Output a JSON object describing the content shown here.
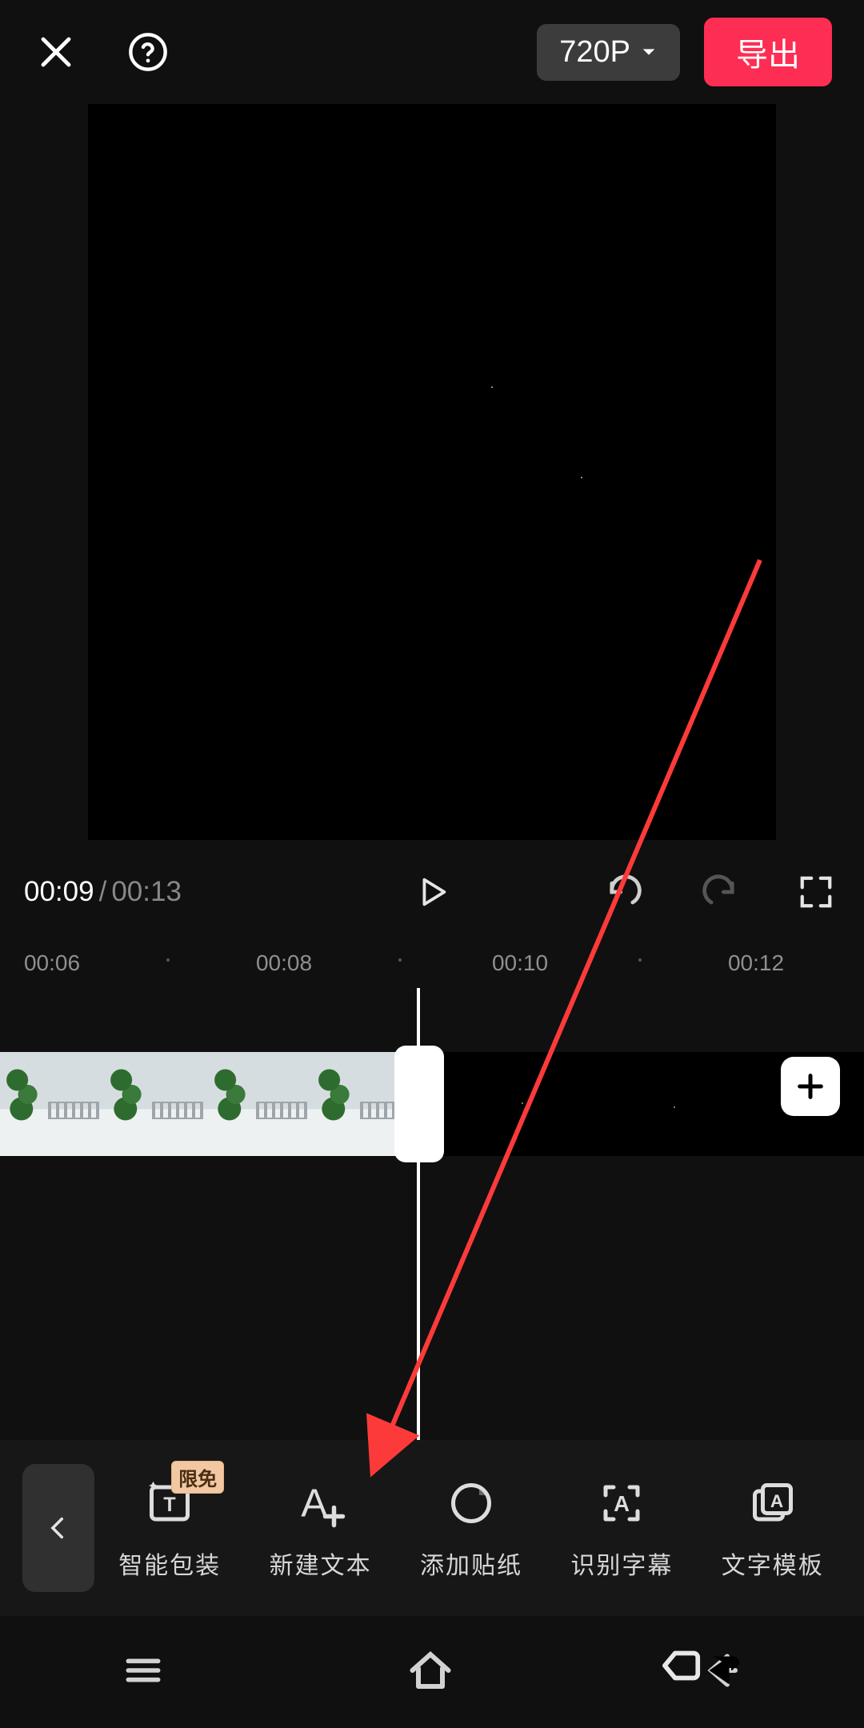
{
  "header": {
    "resolution_label": "720P",
    "export_label": "导出"
  },
  "transport": {
    "current_time": "00:09",
    "separator": "/",
    "total_time": "00:13"
  },
  "ruler": {
    "labels": [
      "00:06",
      "00:08",
      "00:10",
      "00:12"
    ]
  },
  "tools": [
    {
      "label": "智能包装",
      "icon": "text-sparkle",
      "badge": "限免"
    },
    {
      "label": "新建文本",
      "icon": "text-add",
      "badge": null
    },
    {
      "label": "添加贴纸",
      "icon": "sticker",
      "badge": null
    },
    {
      "label": "识别字幕",
      "icon": "caption-detect",
      "badge": null
    },
    {
      "label": "文字模板",
      "icon": "text-template",
      "badge": null
    }
  ],
  "colors": {
    "accent": "#fe2d53",
    "badge_bg": "#f2c8a2"
  }
}
